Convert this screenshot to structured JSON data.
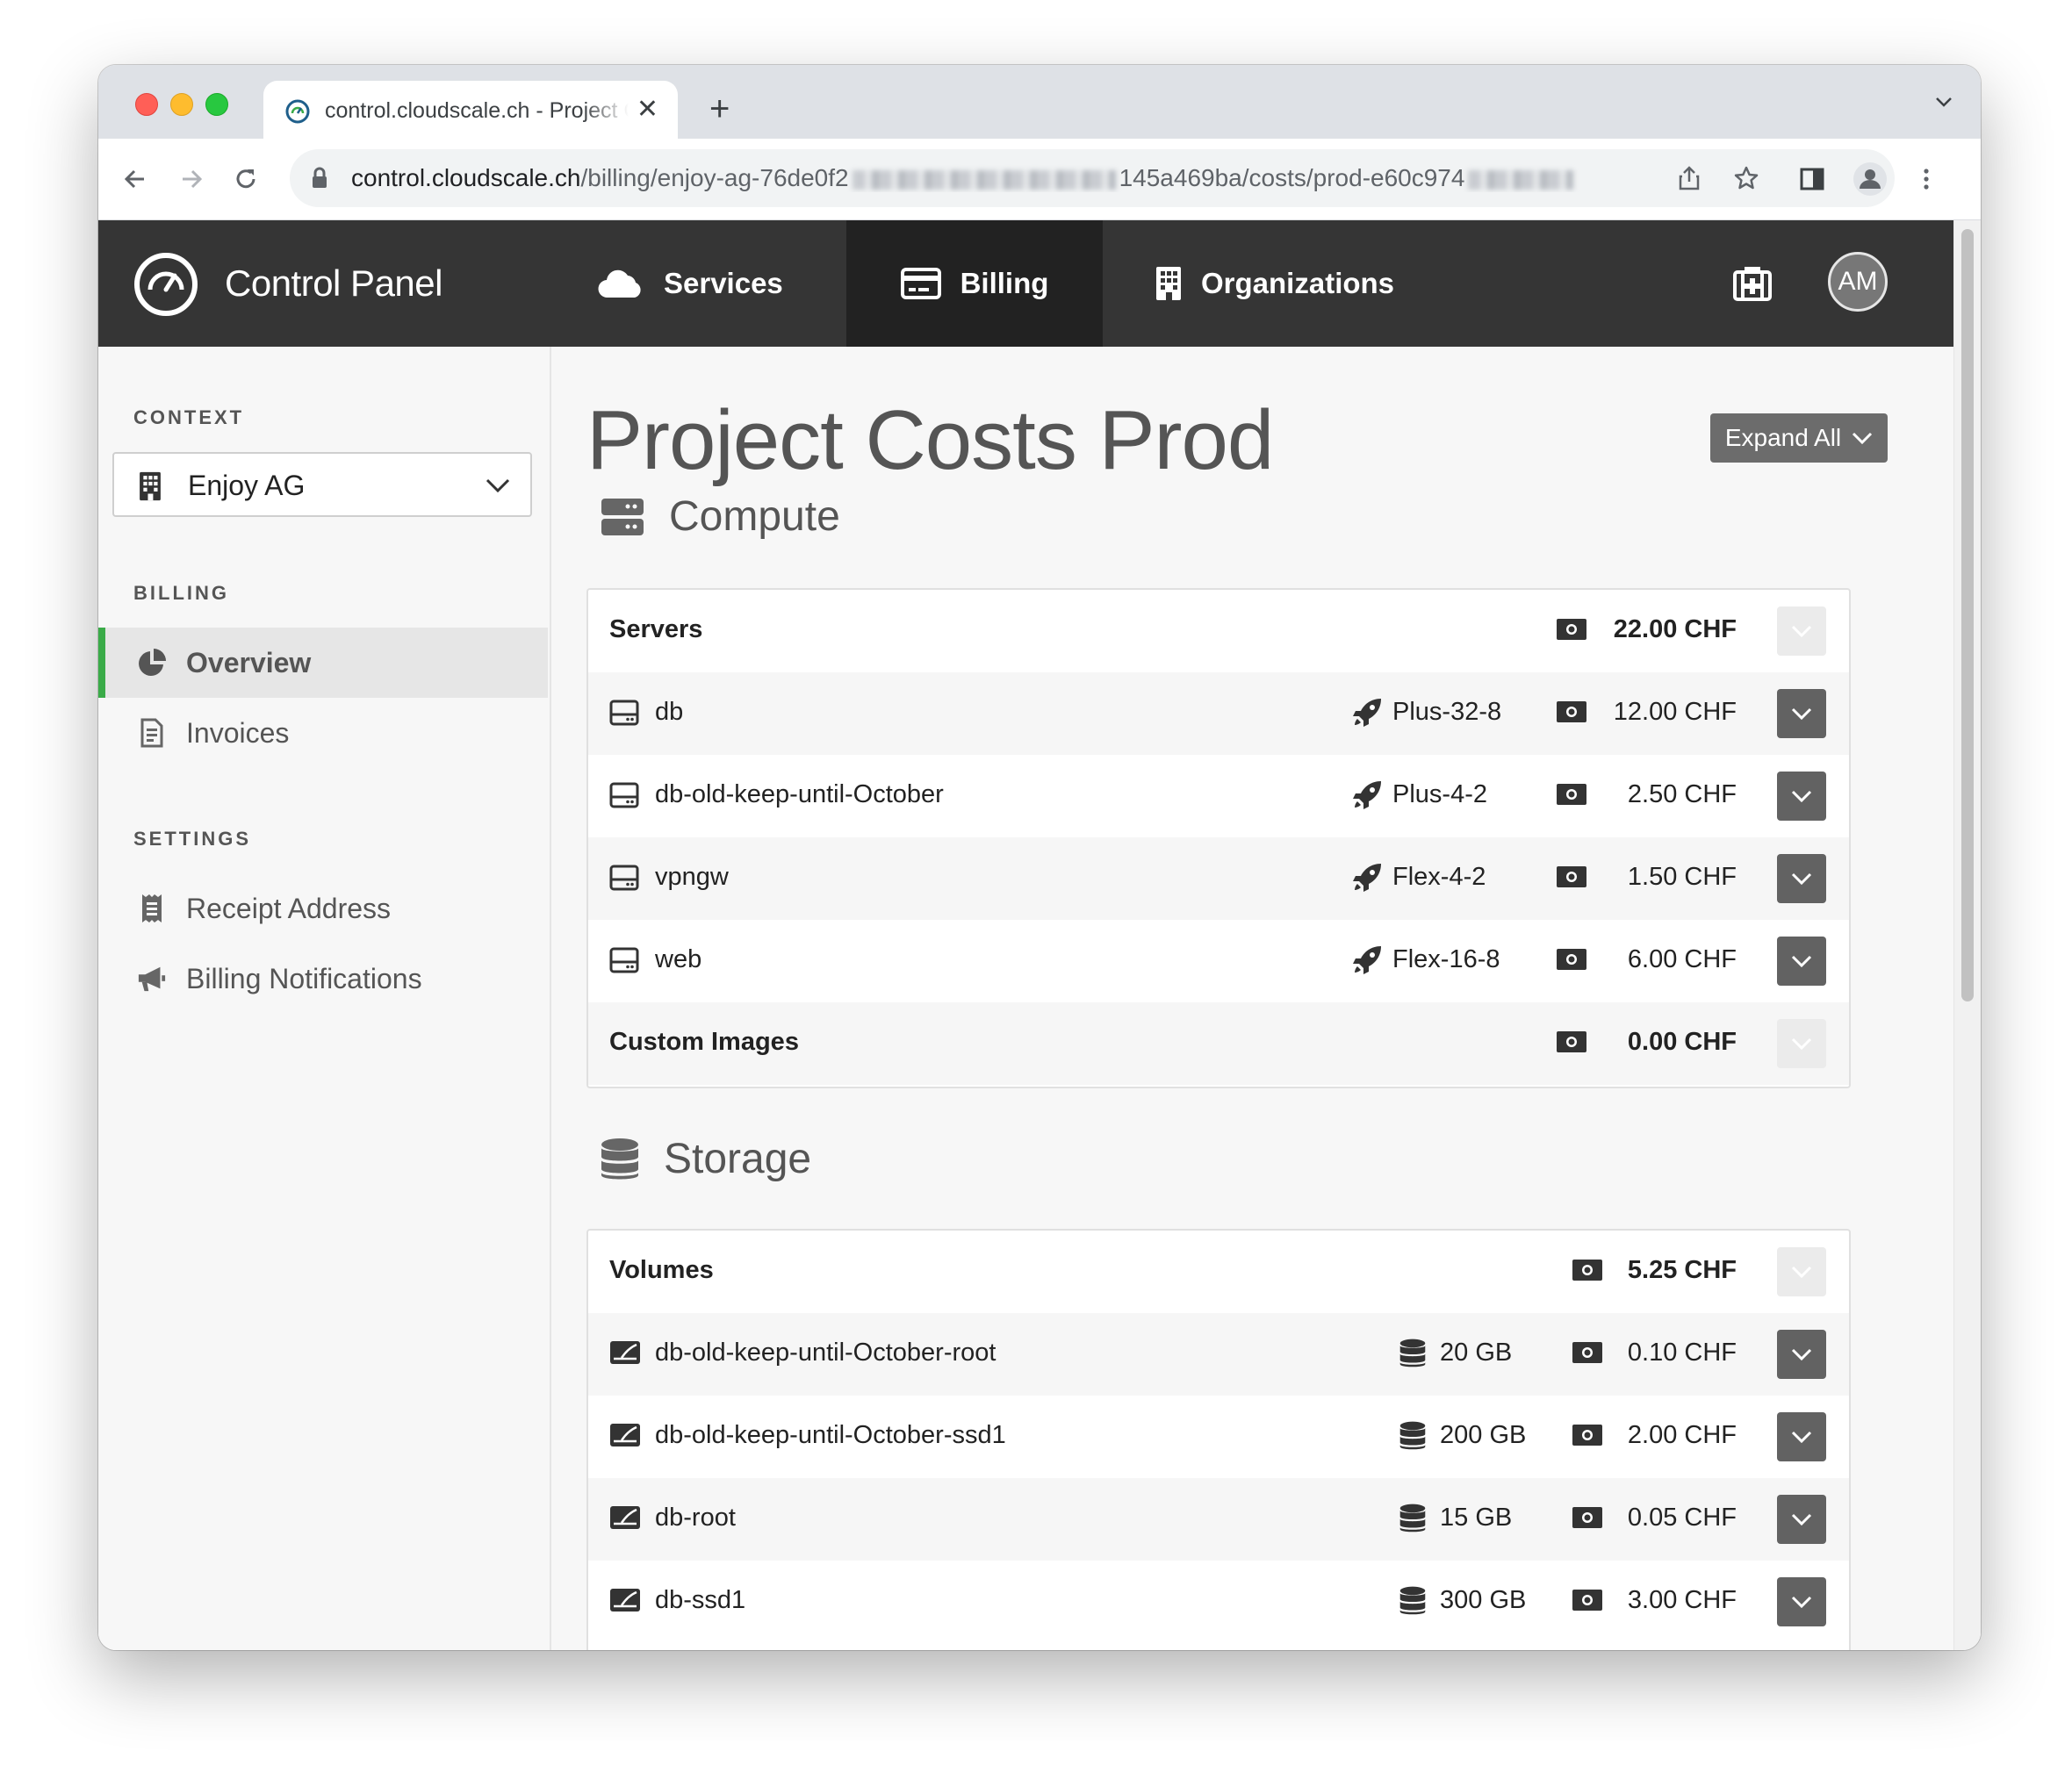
{
  "browser": {
    "tab_title": "control.cloudscale.ch - Project Costs Prod",
    "url_host": "control.cloudscale.ch",
    "url_path_1": "/billing/enjoy-ag-76de0f2",
    "url_path_2": "145a469ba/costs/prod-e60c974"
  },
  "nav": {
    "brand": "Control Panel",
    "items": [
      {
        "label": "Services",
        "icon": "cloud-icon"
      },
      {
        "label": "Billing",
        "icon": "credit-card-icon",
        "active": true
      },
      {
        "label": "Organizations",
        "icon": "building-icon"
      }
    ],
    "avatar": "AM"
  },
  "sidebar": {
    "context_heading": "CONTEXT",
    "context_value": "Enjoy AG",
    "billing_heading": "BILLING",
    "billing_items": [
      {
        "label": "Overview",
        "icon": "chart-pie-icon",
        "active": true
      },
      {
        "label": "Invoices",
        "icon": "file-invoice-icon"
      }
    ],
    "settings_heading": "SETTINGS",
    "settings_items": [
      {
        "label": "Receipt Address",
        "icon": "receipt-icon"
      },
      {
        "label": "Billing Notifications",
        "icon": "bullhorn-icon"
      }
    ]
  },
  "main": {
    "title": "Project Costs Prod",
    "expand_all": "Expand All",
    "compute": {
      "heading": "Compute",
      "servers_label": "Servers",
      "servers_total": "22.00 CHF",
      "servers": [
        {
          "name": "db",
          "flavor": "Plus-32-8",
          "price": "12.00 CHF"
        },
        {
          "name": "db-old-keep-until-October",
          "flavor": "Plus-4-2",
          "price": "2.50 CHF"
        },
        {
          "name": "vpngw",
          "flavor": "Flex-4-2",
          "price": "1.50 CHF"
        },
        {
          "name": "web",
          "flavor": "Flex-16-8",
          "price": "6.00 CHF"
        }
      ],
      "images_label": "Custom Images",
      "images_total": "0.00 CHF"
    },
    "storage": {
      "heading": "Storage",
      "volumes_label": "Volumes",
      "volumes_total": "5.25 CHF",
      "volumes": [
        {
          "name": "db-old-keep-until-October-root",
          "size": "20 GB",
          "price": "0.10 CHF"
        },
        {
          "name": "db-old-keep-until-October-ssd1",
          "size": "200 GB",
          "price": "2.00 CHF"
        },
        {
          "name": "db-root",
          "size": "15 GB",
          "price": "0.05 CHF"
        },
        {
          "name": "db-ssd1",
          "size": "300 GB",
          "price": "3.00 CHF"
        }
      ]
    }
  }
}
